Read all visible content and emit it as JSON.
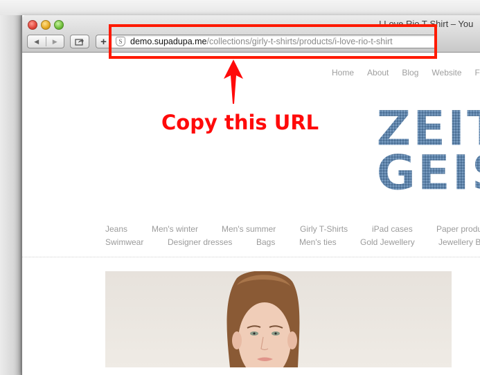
{
  "browser": {
    "window_title": "I Love Rio T-Shirt – You",
    "address_bar": {
      "host": "demo.supadupa.me",
      "path": "/collections/girly-t-shirts/products/i-love-rio-t-shirt",
      "site_icon": "S"
    },
    "buttons": {
      "back_icon": "◀",
      "forward_icon": "▶",
      "add_label": "+"
    }
  },
  "annotation": {
    "callout_text": "Copy this URL",
    "highlight_color": "#ff1a00"
  },
  "site": {
    "top_nav": [
      "Home",
      "About",
      "Blog",
      "Website",
      "F"
    ],
    "logo_text": [
      "ZEIT",
      "GEIS"
    ],
    "logo_color": "#5a7fa6",
    "categories_row1": [
      "Jeans",
      "Men's winter",
      "Men's summer",
      "Girly T-Shirts",
      "iPad cases",
      "Paper produ"
    ],
    "categories_row2": [
      "Swimwear",
      "Designer dresses",
      "Bags",
      "Men's ties",
      "Gold Jewellery",
      "Jewellery B"
    ]
  }
}
